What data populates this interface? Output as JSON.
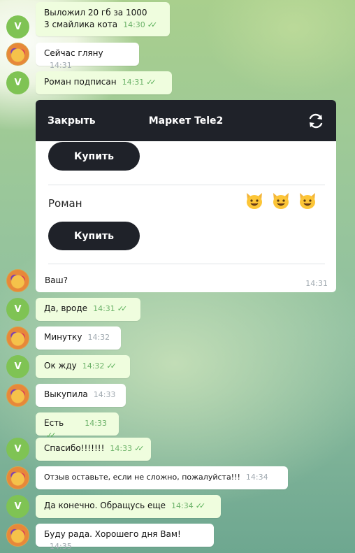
{
  "messages": [
    {
      "line1": "Выложил 20 гб за 1000",
      "line2": "3 смайлика кота",
      "time": "14:30",
      "ticks": "✓✓"
    },
    {
      "text": "Сейчас гляну",
      "time": "14:31"
    },
    {
      "text": "Роман подписан",
      "time": "14:31",
      "ticks": "✓✓"
    },
    {
      "text": "Да, вроде",
      "time": "14:31",
      "ticks": "✓✓"
    },
    {
      "text": "Минутку",
      "time": "14:32"
    },
    {
      "text": "Ок жду",
      "time": "14:32",
      "ticks": "✓✓"
    },
    {
      "text": "Выкупила",
      "time": "14:33"
    },
    {
      "text": "Есть",
      "time": "14:33",
      "ticks": "✓✓"
    },
    {
      "text": "Спасибо!!!!!!!",
      "time": "14:33",
      "ticks": "✓✓"
    },
    {
      "text": "Отзыв оставьте,  если не сложно,  пожалуйста!!!",
      "time": "14:34"
    },
    {
      "text": "Да конечно. Обращусь еще",
      "time": "14:34",
      "ticks": "✓✓"
    },
    {
      "text": "Буду рада. Хорошего дня Вам!",
      "time": "14:35"
    }
  ],
  "avatar_letter": "V",
  "bot_panel": {
    "close_label": "Закрыть",
    "title": "Маркет Tele2",
    "buy_label": "Купить",
    "item_name": "Роман",
    "item_emojis": [
      "😺",
      "😺",
      "😺"
    ],
    "message": "Ваш?",
    "time": "14:31"
  }
}
